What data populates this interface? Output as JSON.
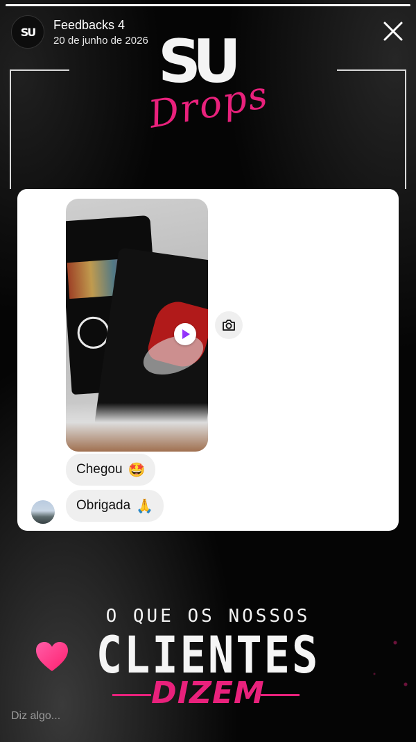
{
  "story": {
    "progress": 1.0,
    "account_name": "Feedbacks 4",
    "date": "20 de junho de 2026",
    "avatar_logo": "SU",
    "close_icon": "close-icon"
  },
  "brand": {
    "logo_main": "SU",
    "logo_script": "Drops",
    "accent_color": "#e9217c"
  },
  "chat": {
    "video_play_icon": "play-icon",
    "camera_icon": "camera-icon",
    "messages": [
      {
        "text": "Chegou",
        "emoji": "🤩"
      },
      {
        "text": "Obrigada",
        "emoji": "🙏"
      }
    ]
  },
  "tagline": {
    "line1": "O QUE OS NOSSOS",
    "line2": "CLIENTES",
    "line3": "DIZEM"
  },
  "footer": {
    "like_icon": "heart-icon",
    "reply_placeholder": "Diz algo..."
  }
}
